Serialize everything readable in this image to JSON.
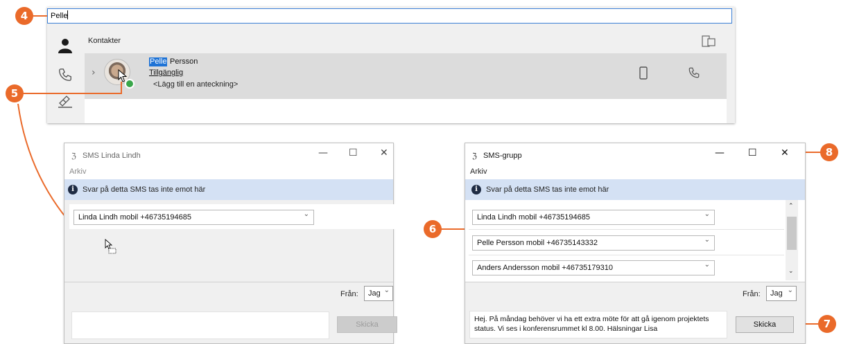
{
  "contacts": {
    "search_value": "Pelle",
    "header_label": "Kontakter",
    "contact": {
      "first_name": "Pelle",
      "last_name": "Persson",
      "status": "Tillgänglig",
      "note": "<Lägg till en anteckning>",
      "presence_color": "#3aa64a"
    }
  },
  "callouts": [
    "4",
    "5",
    "6",
    "7",
    "8"
  ],
  "callout_color": "#ea6a2a",
  "sms_single": {
    "title": "SMS Linda Lindh",
    "menu": "Arkiv",
    "info": "Svar på detta SMS tas inte emot här",
    "recipient": "Linda Lindh mobil +46735194685",
    "from_label": "Från:",
    "from_value": "Jag",
    "message": "",
    "send_label": "Skicka"
  },
  "sms_group": {
    "title": "SMS-grupp",
    "menu": "Arkiv",
    "info": "Svar på detta SMS tas inte emot här",
    "recipients": [
      "Linda Lindh mobil +46735194685",
      "Pelle Persson mobil +46735143332",
      "Anders Andersson mobil +46735179310"
    ],
    "from_label": "Från:",
    "from_value": "Jag",
    "message": "Hej. På måndag behöver vi ha ett extra möte för att gå igenom projektets status. Vi ses i konferensrummet kl 8.00. Hälsningar Lisa",
    "send_label": "Skicka"
  }
}
